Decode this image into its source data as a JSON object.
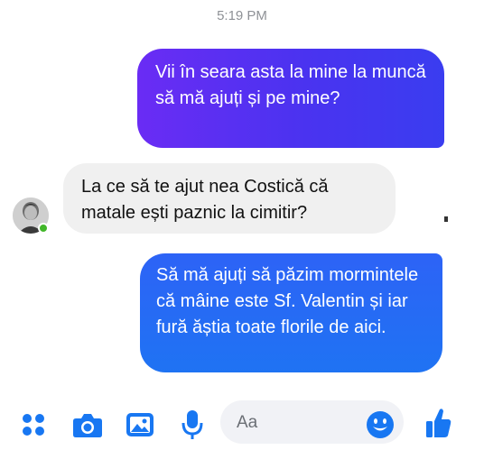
{
  "conversation": {
    "timestamp": "5:19 PM",
    "messages": [
      {
        "sender": "me",
        "text": "Vii în seara asta la mine la muncă să mă ajuți și pe mine?"
      },
      {
        "sender": "contact",
        "text": "La ce să te ajut nea Costică că matale ești paznic la cimitir?"
      },
      {
        "sender": "me",
        "text": "Să mă ajuți să păzim mormintele că mâine este Sf. Valentin și iar fură ăștia toate florile de aici."
      }
    ]
  },
  "contact": {
    "avatar_icon": "person-photo-icon",
    "status": "online",
    "status_color": "#42b72a"
  },
  "composer": {
    "placeholder": "Aa",
    "icons": [
      "menu-dots-icon",
      "camera-icon",
      "image-icon",
      "microphone-icon",
      "emoji-icon",
      "thumbs-up-icon"
    ]
  },
  "colors": {
    "outgoing_bubble_1": "#4a33f0",
    "outgoing_bubble_2": "#1f73f3",
    "incoming_bubble": "#f0f0f0",
    "accent": "#1877f2",
    "timestamp": "#8e9196"
  }
}
